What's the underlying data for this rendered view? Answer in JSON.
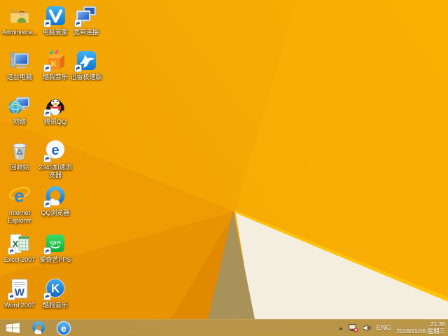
{
  "desktop": {
    "icons": [
      {
        "id": "administrator-folder",
        "label": "Administra..."
      },
      {
        "id": "pc-manager",
        "label": "电脑管家"
      },
      {
        "id": "broadband-connection",
        "label": "宽带连接"
      },
      {
        "id": "this-pc",
        "label": "这台电脑"
      },
      {
        "id": "kuwo-music",
        "label": "酷我音乐"
      },
      {
        "id": "thunder-speed",
        "label": "迅雷极速版"
      },
      {
        "id": "network",
        "label": "网络"
      },
      {
        "id": "tencent-qq",
        "label": "腾讯QQ"
      },
      {
        "id": "recycle-bin",
        "label": "回收站"
      },
      {
        "id": "browser-2345",
        "label": "2345加速浏览器"
      },
      {
        "id": "internet-explorer",
        "label": "Internet Explorer"
      },
      {
        "id": "qq-browser",
        "label": "QQ浏览器"
      },
      {
        "id": "excel-2007",
        "label": "Excel 2007"
      },
      {
        "id": "iqiyi-pps",
        "label": "爱奇艺PPS"
      },
      {
        "id": "word-2007",
        "label": "Word 2007"
      },
      {
        "id": "kugou-music",
        "label": "酷狗音乐"
      }
    ]
  },
  "taskbar": {
    "pinned": [
      {
        "id": "qq-browser"
      },
      {
        "id": "internet-explorer"
      }
    ],
    "tray": {
      "hidden_icons": "show-hidden-icons",
      "network_status": "network-disconnected",
      "volume": "volume",
      "language": "ENG",
      "time": "21:38",
      "date": "2016/11/16 星期三"
    }
  },
  "logos": {
    "ie_e": "e",
    "browser2345_e": "e",
    "kuwo_k": "K",
    "kugou_k": "K",
    "excel_x": "X",
    "word_w": "W",
    "iqiyi": "iQIYI"
  },
  "colors": {
    "wallpaper_orange": "#F5A703",
    "wallpaper_cream": "#F4EEE0",
    "wallpaper_khaki": "#A8925A",
    "highlight_edge": "#FFC206",
    "taskbar_tint": "#B6914E"
  }
}
